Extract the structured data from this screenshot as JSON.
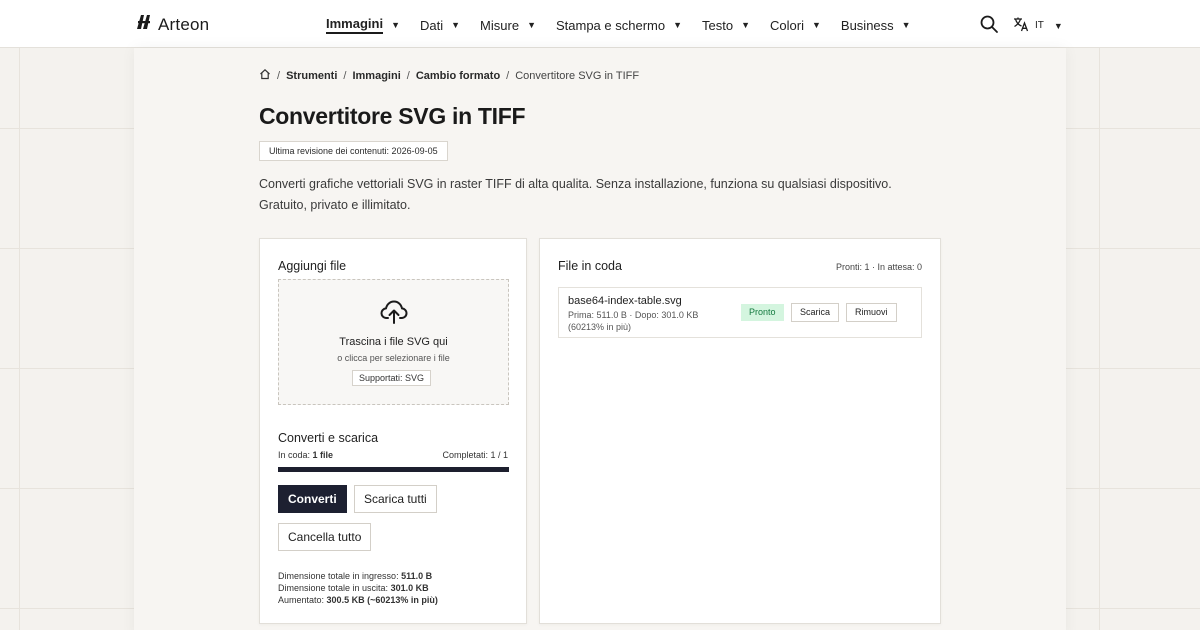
{
  "brand": {
    "name": "Arteon",
    "logo_icon": "arteon-logo-icon"
  },
  "nav": {
    "items": [
      {
        "label": "Immagini",
        "active": true
      },
      {
        "label": "Dati",
        "active": false
      },
      {
        "label": "Misure",
        "active": false
      },
      {
        "label": "Stampa e schermo",
        "active": false
      },
      {
        "label": "Testo",
        "active": false
      },
      {
        "label": "Colori",
        "active": false
      },
      {
        "label": "Business",
        "active": false
      }
    ],
    "caret_icon": "caret-down-icon",
    "search_icon": "search-icon",
    "language": {
      "icon": "translate-icon",
      "code": "IT"
    }
  },
  "breadcrumb": {
    "home_icon": "home-icon",
    "separator": "/",
    "links": [
      "Strumenti",
      "Immagini",
      "Cambio formato"
    ],
    "current": "Convertitore SVG in TIFF"
  },
  "page": {
    "title": "Convertitore SVG in TIFF",
    "revision": "Ultima revisione dei contenuti: 2026-09-05",
    "description": "Converti grafiche vettoriali SVG in raster TIFF di alta qualita. Senza installazione, funziona su qualsiasi dispositivo. Gratuito, privato e illimitato."
  },
  "add_files": {
    "heading": "Aggiungi file",
    "drop_title": "Trascina i file SVG qui",
    "drop_sub": "o clicca per selezionare i file",
    "supported": "Supportati: SVG",
    "upload_icon": "cloud-upload-icon"
  },
  "convert": {
    "heading": "Converti e scarica",
    "queued_label": "In coda:",
    "queued_value": "1 file",
    "completed": "Completati: 1 / 1",
    "progress": 1.0,
    "convert_btn": "Converti",
    "download_all_btn": "Scarica tutti",
    "cancel_all_btn": "Cancella tutto"
  },
  "totals": {
    "in_label": "Dimensione totale in ingresso:",
    "in_value": "511.0 B",
    "out_label": "Dimensione totale in uscita:",
    "out_value": "301.0 KB",
    "inc_label": "Aumentato:",
    "inc_value": "300.5 KB (~60213% in più)"
  },
  "queue": {
    "heading": "File in coda",
    "status": "Pronti: 1 · In attesa: 0",
    "files": [
      {
        "name": "base64-index-table.svg",
        "meta": "Prima: 511.0 B · Dopo: 301.0 KB (60213% in più)",
        "badge": "Pronto",
        "download_btn": "Scarica",
        "remove_btn": "Rimuovi"
      }
    ]
  },
  "colors": {
    "accent": "#1d2031",
    "ready_bg": "#d4f5df",
    "ready_text": "#137a3f",
    "page_bg": "#f4f2ee"
  }
}
